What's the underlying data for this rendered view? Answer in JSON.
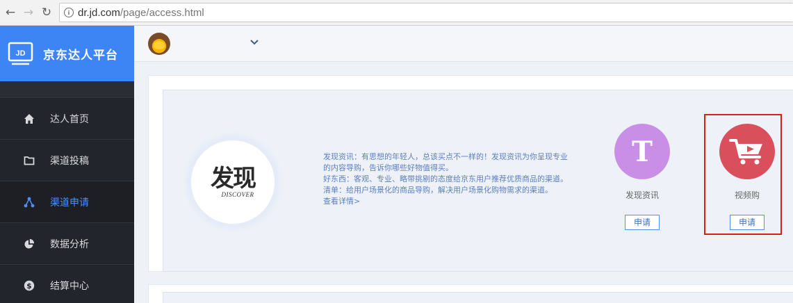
{
  "browser": {
    "url_host": "dr.jd.com",
    "url_path": "/page/access.html"
  },
  "sidebar": {
    "logo_text": "JD",
    "title": "京东达人平台",
    "items": [
      {
        "label": "达人首页",
        "icon": "home-icon",
        "active": false
      },
      {
        "label": "渠道投稿",
        "icon": "folder-icon",
        "active": false
      },
      {
        "label": "渠道申请",
        "icon": "share-nodes-icon",
        "active": true
      },
      {
        "label": "数据分析",
        "icon": "pie-chart-icon",
        "active": false
      },
      {
        "label": "结算中心",
        "icon": "dollar-icon",
        "active": false
      }
    ]
  },
  "channel": {
    "logo_cn": "发现",
    "logo_en": "DISCOVER",
    "desc_lines": [
      "发现资讯：有思想的年轻人，总该买点不一样的！发现资讯为你呈现专业",
      "的内容导购，告诉你哪些好物值得买。",
      "好东西：客观、专业、略带挑剔的态度给京东用户推荐优质商品的渠道。",
      "清单：给用户场景化的商品导购，解决用户场景化购物需求的渠道。"
    ],
    "more_link": "查看详情>",
    "apps": [
      {
        "name": "发现资讯",
        "letter": "T",
        "apply_label": "申请",
        "color": "#c98fe6"
      },
      {
        "name": "视频购",
        "icon": "video-cart-icon",
        "apply_label": "申请",
        "color": "#d9505c"
      }
    ]
  },
  "colors": {
    "brand_blue": "#3d84f5",
    "sidebar_bg": "#2b2d35",
    "highlight_red": "#d91e18"
  }
}
